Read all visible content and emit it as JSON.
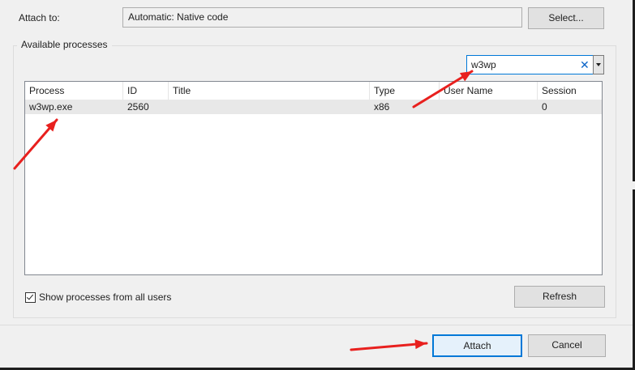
{
  "attach": {
    "label": "Attach to:",
    "value": "Automatic: Native code",
    "select_button": "Select..."
  },
  "processes_group": {
    "label": "Available processes",
    "filter": {
      "value": "w3wp",
      "clear_icon": "close-icon",
      "dropdown_icon": "chevron-down-icon"
    },
    "columns": [
      "Process",
      "ID",
      "Title",
      "Type",
      "User Name",
      "Session"
    ],
    "rows": [
      {
        "process": "w3wp.exe",
        "id": "2560",
        "title": "",
        "type": "x86",
        "user_name": "",
        "session": "0"
      }
    ],
    "show_all_users": {
      "label": "Show processes from all users",
      "checked": true
    },
    "refresh_button": "Refresh"
  },
  "footer": {
    "attach_button": "Attach",
    "cancel_button": "Cancel"
  },
  "annotation_color": "#e8201e"
}
